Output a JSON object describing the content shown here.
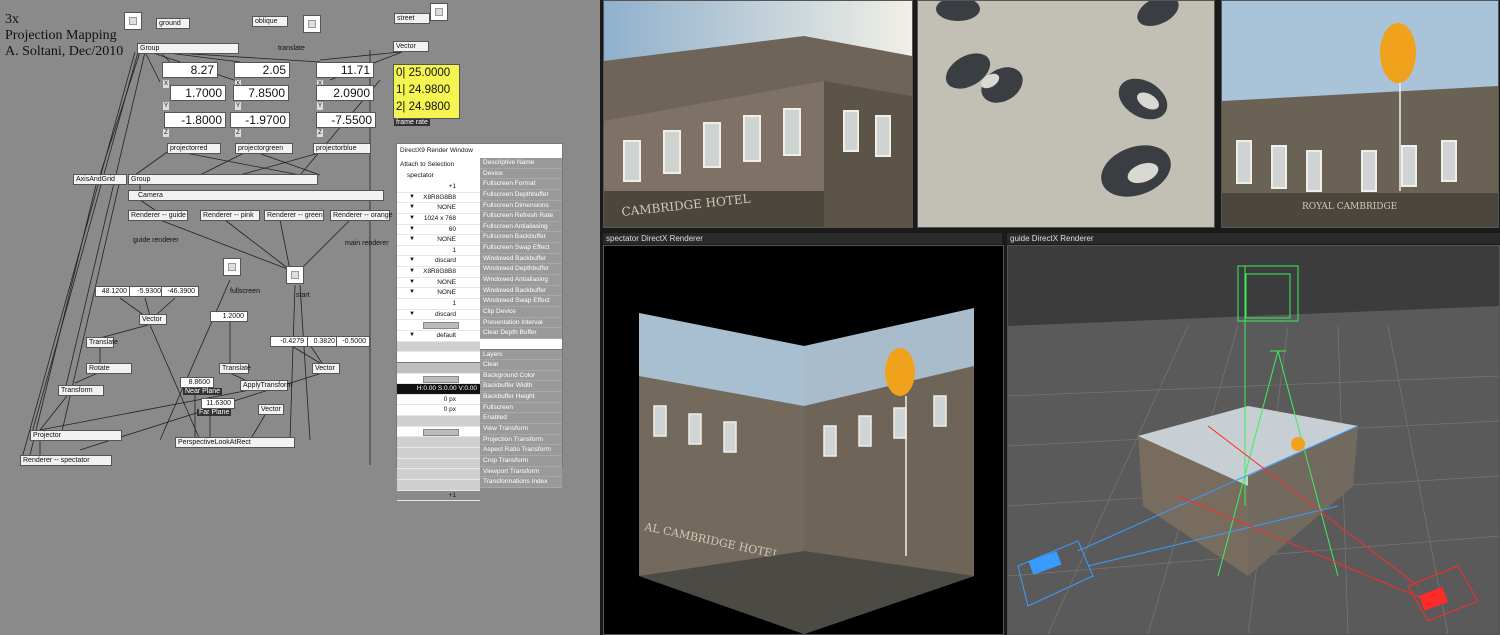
{
  "title": {
    "line1": "3x",
    "line2": "Projection Mapping",
    "line3": "A. Soltani, Dec/2010"
  },
  "patch": {
    "nodes": {
      "ground": "ground",
      "oblique": "oblique",
      "street": "street",
      "group_top": "Group",
      "translate": "translate",
      "vector_top": "Vector",
      "projectorred": "projectorred",
      "projectorgreen": "projectorgreen",
      "projectorblue": "projectorblue",
      "axis_and_grid": "AxisAndGrid",
      "group_mid": "Group",
      "camera": "Camera",
      "renderer_guide": "Renderer -- guide",
      "renderer_pink": "Renderer -- pink",
      "renderer_green": "Renderer -- green",
      "renderer_orange": "Renderer -- orange",
      "guide_renderer": "guide renderer",
      "main_renderer": "main renderer",
      "fullscreen": "fullscreen",
      "start": "start",
      "vector_cam": "Vector",
      "translate1": "Translate",
      "rotate": "Rotate",
      "transform": "Transform",
      "translate2": "Translate",
      "apply_transform": "ApplyTransform",
      "near_plane": "Near Plane",
      "far_plane": "Far Plane",
      "vector_small": "Vector",
      "vector_right": "Vector",
      "projector": "Projector",
      "perspective": "PerspectiveLookAtRect",
      "renderer_spectator": "Renderer -- spectator",
      "frame_rate": "frame rate"
    },
    "numbers": {
      "red": [
        "8.27",
        "1.7000",
        "-1.8000"
      ],
      "green": [
        "2.05",
        "7.8500",
        "-1.9700"
      ],
      "blue": [
        "11.71",
        "2.0900",
        "-7.5500"
      ],
      "axis_labels": [
        "X",
        "Y",
        "Z"
      ],
      "cam": [
        "48.1200",
        "-5.9300",
        "-46.3900"
      ],
      "fov": "1.2000",
      "near": "8.8600",
      "far": "11.6300",
      "vec3": [
        "-0.4279",
        "0.3820",
        "-0.5000"
      ]
    },
    "yellow": [
      "0|  25.0000",
      "1|  24.9800",
      "2|  24.9800"
    ]
  },
  "inspector": {
    "title": "DirectX9 Render Window",
    "attach": "Attach to Selection",
    "selected": "spectator",
    "values": [
      "+1",
      "X8R8G8B8",
      "NONE",
      "1024 x 768",
      "60",
      "NONE",
      "1",
      "discard",
      "X8R8G8B8",
      "NONE",
      "NONE",
      "1",
      "discard",
      "",
      "default",
      "",
      "",
      "",
      "H:0.00  S:0.00  V:0.00",
      "0 px",
      "0 px",
      "",
      "",
      "",
      "",
      "",
      "",
      "",
      "+1"
    ],
    "pins": [
      "Descriptive Name",
      "Device",
      "Fullscreen Format",
      "Fullscreen Depthbuffer",
      "Fullscreen Dimensions",
      "Fullscreen Refresh Rate",
      "Fullscreen Antialiasing",
      "Fullscreen Backbuffer",
      "Fullscreen Swap Effect",
      "Windowed Backbuffer",
      "Windowed Depthbuffer",
      "Windowed Antialiasing",
      "Windowed Backbuffer",
      "Windowed Swap Effect",
      "Clip Device",
      "Presentation Interval",
      "Clear Depth Buffer",
      "",
      "Layers",
      "Clear",
      "Background Color",
      "Backbuffer Width",
      "Backbuffer Height",
      "Fullscreen",
      "Enabled",
      "View Transform",
      "Projection Transform",
      "Aspect Ratio Transform",
      "Crop Transform",
      "Viewport Transform",
      "Transformations Index"
    ]
  },
  "viewports": {
    "spectator_header": "spectator  DirectX Renderer",
    "guide_header": "guide  DirectX Renderer",
    "hotel_sign": "CAMBRIDGE HOTEL",
    "hotel_sign_mirror": "ROYAL CAMBRIDGE",
    "cube_sign": "AL CAMBRIDGE HOTEL"
  },
  "colors": {
    "patch_bg": "#8a8a8a",
    "highlight": "#f5f552",
    "projector_red": "#ff2a2a",
    "projector_green": "#2aff4a",
    "projector_blue": "#3a9bff"
  }
}
